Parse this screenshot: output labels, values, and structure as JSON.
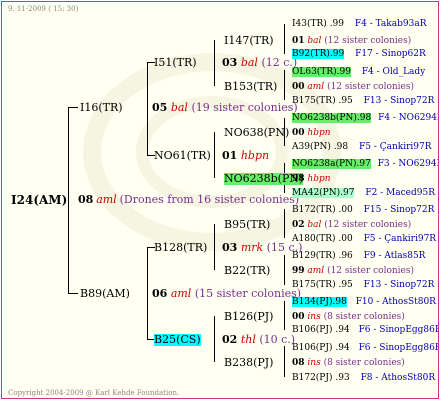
{
  "date": "9. 11-2009 ( 15: 30)",
  "copyright": "Copyright 2004-2009 @ Karl Kehde Foundation.",
  "root": {
    "id": "I24(AM)",
    "year": "08",
    "code": "aml",
    "note": "(Drones from 16 sister colonies)"
  },
  "l1": [
    {
      "id": "I16(TR)",
      "year": "05",
      "code": "bal",
      "note": "(19 sister colonies)"
    },
    {
      "id": "B89(AM)",
      "year": "06",
      "code": "aml",
      "note": "(15 sister colonies)"
    }
  ],
  "l2": [
    {
      "id": "I51(TR)",
      "year": "03",
      "code": "bal",
      "note": "(12 c.)"
    },
    {
      "id": "NO61(TR)",
      "year": "01",
      "code": "hbpn",
      "note": ""
    },
    {
      "id": "B128(TR)",
      "year": "03",
      "code": "mrk",
      "note": "(15 c.)"
    },
    {
      "id": "B25(CS)",
      "year": "02",
      "code": "thl",
      "note": "(10 c.)"
    }
  ],
  "l3": [
    {
      "id": "I147(TR)",
      "year": "01",
      "code": "bal",
      "note": "(12 sister colonies)"
    },
    {
      "id": "B153(TR)",
      "year": "00",
      "code": "aml",
      "note": "(12 sister colonies)"
    },
    {
      "id": "NO638(PN)",
      "year": "00",
      "code": "hbpn",
      "note": ""
    },
    {
      "id": "NO6238b(PN)",
      "year": "98",
      "code": "hbpn",
      "note": ""
    },
    {
      "id": "B95(TR)",
      "year": "02",
      "code": "bal",
      "note": "(12 sister colonies)"
    },
    {
      "id": "B22(TR)",
      "year": "99",
      "code": "aml",
      "note": "(12 sister colonies)"
    },
    {
      "id": "B126(PJ)",
      "year": "00",
      "code": "ins",
      "note": "(8 sister colonies)"
    },
    {
      "id": "B238(PJ)",
      "year": "08",
      "code": "ins",
      "note": "(8 sister colonies)"
    }
  ],
  "l4": [
    {
      "id": "I43(TR)",
      "pct": ".99",
      "ref": "F4 - Takab93aR"
    },
    {
      "id": "B92(TR)",
      "pct": ".99",
      "ref": "F17 - Sinop62R"
    },
    {
      "id": "OL63(TR)",
      "pct": ".99",
      "ref": "F4 - Old_Lady"
    },
    {
      "id": "B175(TR)",
      "pct": ".95",
      "ref": "F13 - Sinop72R"
    },
    {
      "id": "NO6238b(PN)",
      "pct": ".98",
      "ref": "F4 - NO6294R"
    },
    {
      "id": "A39(PN)",
      "pct": ".98",
      "ref": "F5 - Çankiri97R"
    },
    {
      "id": "NO6238a(PN)",
      "pct": ".97",
      "ref": "F3 - NO6294R"
    },
    {
      "id": "MA42(PN)",
      "pct": ".97",
      "ref": "F2 - Maced95R"
    },
    {
      "id": "B172(TR)",
      "pct": ".00",
      "ref": "F15 - Sinop72R"
    },
    {
      "id": "A180(TR)",
      "pct": ".00",
      "ref": "F5 - Çankiri97R"
    },
    {
      "id": "B129(TR)",
      "pct": ".96",
      "ref": "F9 - Atlas85R"
    },
    {
      "id": "B175(TR)",
      "pct": ".95",
      "ref": "F13 - Sinop72R"
    },
    {
      "id": "B134(PJ)",
      "pct": ".98",
      "ref": "F10 - AthosSt80R"
    },
    {
      "id": "B106(PJ)",
      "pct": ".94",
      "ref": "F6 - SinopEgg86R"
    },
    {
      "id": "B106(PJ)",
      "pct": ".94",
      "ref": "F6 - SinopEgg86R"
    },
    {
      "id": "B172(PJ)",
      "pct": ".93",
      "ref": "F8 - AthosSt80R"
    }
  ]
}
